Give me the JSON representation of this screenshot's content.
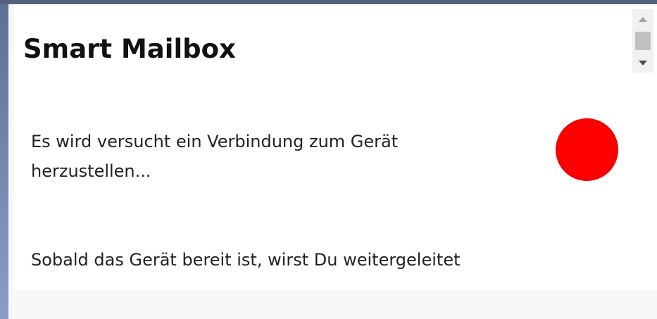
{
  "app": {
    "title": "Smart Mailbox"
  },
  "connection": {
    "status_text": "Es wird versucht ein Verbindung zum Gerät herzustellen...",
    "status_color": "#ff0000",
    "status_icon": "status-indicator-circle"
  },
  "redirect": {
    "message": "Sobald das Gerät bereit ist, wirst Du weitergeleitet"
  },
  "scrollbar": {
    "up_icon": "arrow-up-icon",
    "down_icon": "arrow-down-icon"
  }
}
